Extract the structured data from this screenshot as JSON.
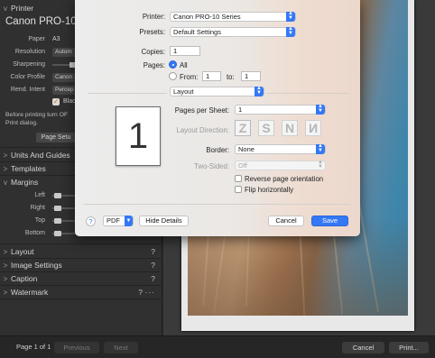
{
  "left_panel": {
    "printer_section": "Printer",
    "printer_name": "Canon PRO-10",
    "paper_label": "Paper",
    "paper_value": "A3",
    "resolution_label": "Resolution",
    "resolution_value": "Autom",
    "sharpening_label": "Sharpening",
    "color_profile_label": "Color Profile",
    "color_profile_value": "Canon",
    "rend_intent_label": "Rend. Intent",
    "rend_intent_value": "Percep",
    "black_point_label": "Blac",
    "note_line1": "Before printing turn OF",
    "note_line2": "Print dialog.",
    "page_setup_button": "Page Setu",
    "units_guides": "Units And Guides",
    "templates": "Templates",
    "margins": "Margins",
    "margin_left": "Left",
    "margin_right": "Right",
    "margin_top": "Top",
    "margin_bottom": "Bottom",
    "layout": "Layout",
    "image_settings": "Image Settings",
    "caption": "Caption",
    "watermark": "Watermark",
    "help": "?",
    "more": "···",
    "expand_icon": ">",
    "collapse_icon": "v"
  },
  "bottom_bar": {
    "page_info": "Page 1 of 1",
    "previous": "Previous",
    "next": "Next",
    "cancel": "Cancel",
    "print": "Print..."
  },
  "dialog": {
    "printer_label": "Printer:",
    "printer_value": "Canon PRO-10 Series",
    "presets_label": "Presets:",
    "presets_value": "Default Settings",
    "copies_label": "Copies:",
    "copies_value": "1",
    "pages_label": "Pages:",
    "pages_all": "All",
    "from_label": "From:",
    "from_value": "1",
    "to_label": "to:",
    "to_value": "1",
    "section_value": "Layout",
    "preview_number": "1",
    "pages_per_sheet_label": "Pages per Sheet:",
    "pages_per_sheet_value": "1",
    "layout_direction_label": "Layout Direction:",
    "direction_glyphs": [
      "Z",
      "S",
      "N",
      "N"
    ],
    "border_label": "Border:",
    "border_value": "None",
    "two_sided_label": "Two-Sided:",
    "two_sided_value": "Off",
    "reverse_label": "Reverse page orientation",
    "flip_label": "Flip horizontally",
    "help": "?",
    "pdf": "PDF",
    "hide_details": "Hide Details",
    "cancel": "Cancel",
    "save": "Save"
  },
  "colors": {
    "accent": "#3478f6",
    "panel": "#303030",
    "bottom_bar": "#262626"
  }
}
